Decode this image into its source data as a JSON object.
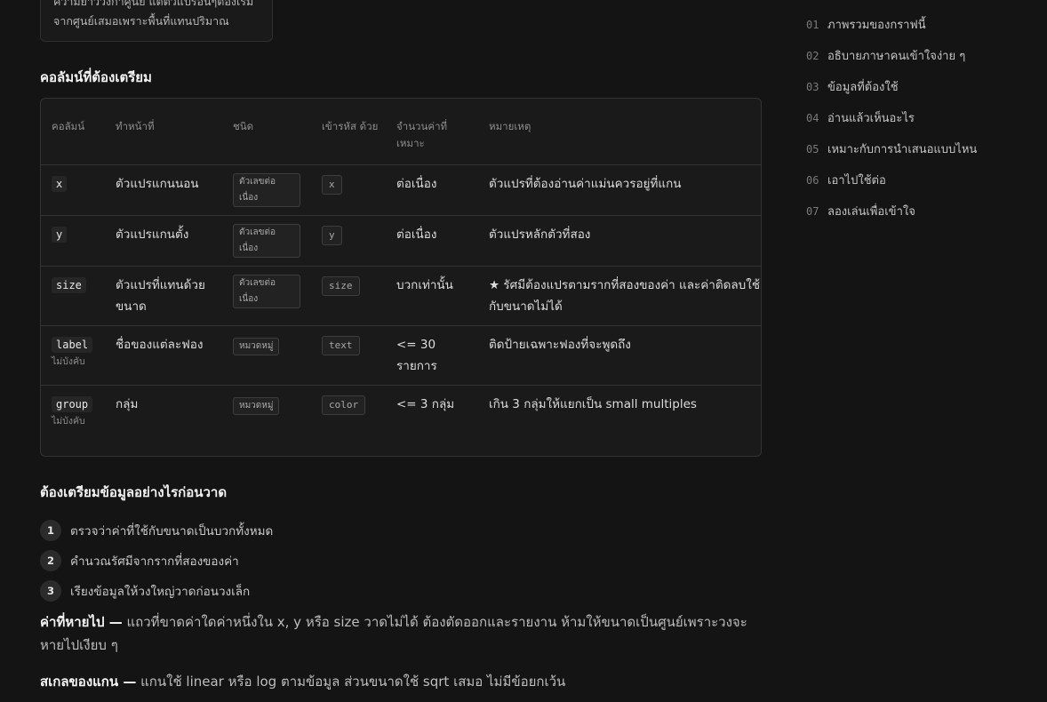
{
  "callout": {
    "line1": "ความยาววงกาศูนย์ แต่ตัวแปรอื่นๆต้องเริ่ม",
    "line2": "จากศูนย์เสมอเพราะพื้นที่แทนปริมาณ"
  },
  "columns_title": "คอลัมน์ที่ต้องเตรียม",
  "table": {
    "headers": [
      "คอลัมน์",
      "ทำหน้าที่",
      "ชนิด",
      "เข้ารหัส ด้วย",
      "จำนวนค่าที่ เหมาะ",
      "หมายเหตุ"
    ],
    "rows": [
      {
        "col": "x",
        "optional": "",
        "role": "ตัวแปรแกนนอน",
        "type": "ตัวเลขต่อเนื่อง",
        "enc": "x",
        "count": "ต่อเนื่อง",
        "note": "ตัวแปรที่ต้องอ่านค่าแม่นควรอยู่ที่แกน"
      },
      {
        "col": "y",
        "optional": "",
        "role": "ตัวแปรแกนตั้ง",
        "type": "ตัวเลขต่อเนื่อง",
        "enc": "y",
        "count": "ต่อเนื่อง",
        "note": "ตัวแปรหลักตัวที่สอง"
      },
      {
        "col": "size",
        "optional": "",
        "role": "ตัวแปรที่แทนด้วยขนาด",
        "type": "ตัวเลขต่อเนื่อง",
        "enc": "size",
        "count": "บวกเท่านั้น",
        "note": "★ รัศมีต้องแปรตามรากที่สองของค่า และค่าติดลบใช้กับขนาดไม่ได้"
      },
      {
        "col": "label",
        "optional": "ไม่บังคับ",
        "role": "ชื่อของแต่ละฟอง",
        "type": "หมวดหมู่",
        "enc": "text",
        "count": "<= 30 รายการ",
        "note": "ติดป้ายเฉพาะฟองที่จะพูดถึง"
      },
      {
        "col": "group",
        "optional": "ไม่บังคับ",
        "role": "กลุ่ม",
        "type": "หมวดหมู่",
        "enc": "color",
        "count": "<= 3 กลุ่ม",
        "note": "เกิน 3 กลุ่มให้แยกเป็น small multiples"
      }
    ]
  },
  "prep_title": "ต้องเตรียมข้อมูลอย่างไรก่อนวาด",
  "steps": [
    {
      "n": "1",
      "text": "ตรวจว่าค่าที่ใช้กับขนาดเป็นบวกทั้งหมด"
    },
    {
      "n": "2",
      "text": "คำนวณรัศมีจากรากที่สองของค่า"
    },
    {
      "n": "3",
      "text": "เรียงข้อมูลให้วงใหญ่วาดก่อนวงเล็ก"
    }
  ],
  "missing": {
    "label": "ค่าที่หายไป —",
    "text": " แถวที่ขาดค่าใดค่าหนึ่งใน x, y หรือ size วาดไม่ได้ ต้องตัดออกและรายงาน ห้ามให้ขนาดเป็นศูนย์เพราะวงจะหายไปเงียบ ๆ"
  },
  "scale": {
    "label": "สเกลของแกน —",
    "text": " แกนใช้ linear หรือ log ตามข้อมูล ส่วนขนาดใช้ sqrt เสมอ ไม่มีข้อยกเว้น"
  },
  "toc": [
    {
      "n": "01",
      "label": "ภาพรวมของกราฟนี้"
    },
    {
      "n": "02",
      "label": "อธิบายภาษาคนเข้าใจง่าย ๆ"
    },
    {
      "n": "03",
      "label": "ข้อมูลที่ต้องใช้"
    },
    {
      "n": "04",
      "label": "อ่านแล้วเห็นอะไร"
    },
    {
      "n": "05",
      "label": "เหมาะกับการนำเสนอแบบไหน"
    },
    {
      "n": "06",
      "label": "เอาไปใช้ต่อ"
    },
    {
      "n": "07",
      "label": "ลองเล่นเพื่อเข้าใจ"
    }
  ]
}
